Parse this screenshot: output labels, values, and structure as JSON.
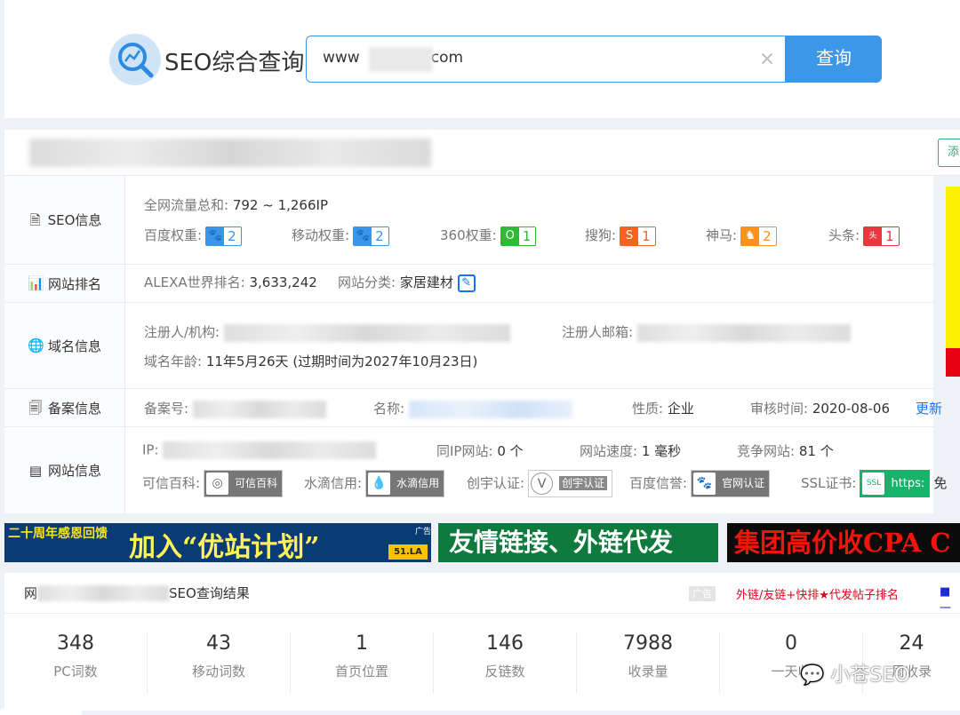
{
  "header": {
    "brand": "SEO综合查询",
    "search_value_prefix": "www",
    "search_value_suffix": "com",
    "clear_icon": "×",
    "search_button": "查询"
  },
  "title_row": {
    "add_button": "添"
  },
  "rows": {
    "seo": {
      "label": "SEO信息",
      "traffic_label": "全网流量总和:",
      "traffic_value": "792 ~ 1,266IP",
      "baidu_label": "百度权重:",
      "baidu_value": "2",
      "mobile_label": "移动权重:",
      "mobile_value": "2",
      "so360_label": "360权重:",
      "so360_value": "1",
      "sogou_label": "搜狗:",
      "sogou_value": "1",
      "shenma_label": "神马:",
      "shenma_value": "2",
      "toutiao_label": "头条:",
      "toutiao_value": "1"
    },
    "rank": {
      "label": "网站排名",
      "alexa_label": "ALEXA世界排名:",
      "alexa_value": "3,633,242",
      "category_label": "网站分类:",
      "category_value": "家居建材"
    },
    "domain": {
      "label": "域名信息",
      "registrant_label": "注册人/机构:",
      "email_label": "注册人邮箱:",
      "age_label": "域名年龄:",
      "age_value": "11年5月26天 (过期时间为2027年10月23日)"
    },
    "icp": {
      "label": "备案信息",
      "number_label": "备案号:",
      "name_label": "名称:",
      "nature_label": "性质:",
      "nature_value": "企业",
      "review_label": "审核时间:",
      "review_value": "2020-08-06",
      "update_link": "更新"
    },
    "site": {
      "label": "网站信息",
      "ip_label": "IP:",
      "same_ip_label": "同IP网站:",
      "same_ip_value": "0 个",
      "speed_label": "网站速度:",
      "speed_value": "1 毫秒",
      "compete_label": "竞争网站:",
      "compete_value": "81 个",
      "kexin_label": "可信百科:",
      "kexin_badge": "可信百科",
      "shuidi_label": "水滴信用:",
      "shuidi_badge": "水滴信用",
      "chuangyu_label": "创宇认证:",
      "chuangyu_badge": "创宇认证",
      "baidu_trust_label": "百度信誉:",
      "baidu_trust_badge": "官网认证",
      "ssl_label": "SSL证书:",
      "ssl_badge": "https:",
      "ssl_after": "免"
    }
  },
  "banners": {
    "b1_left": "二十周年感恩回馈",
    "b1_main": "加入“优站计划”",
    "b1_logo": "51.LA",
    "b1_ad": "广告",
    "b2": "友情链接、外链代发",
    "b3": "集团高价收CPA C"
  },
  "results": {
    "title_prefix": "网",
    "title_suffix": "SEO查询结果",
    "ad_tag": "广告",
    "ad_link": "外链/友链+快排★代发帖子排名",
    "ad_link2": "■ 一",
    "stats": [
      {
        "value": "348",
        "label": "PC词数"
      },
      {
        "value": "43",
        "label": "移动词数"
      },
      {
        "value": "1",
        "label": "首页位置"
      },
      {
        "value": "146",
        "label": "反链数"
      },
      {
        "value": "7988",
        "label": "收录量"
      },
      {
        "value": "0",
        "label": "一天收"
      },
      {
        "value": "24",
        "label": "周收录"
      }
    ]
  },
  "watermark": "小苍SEO"
}
